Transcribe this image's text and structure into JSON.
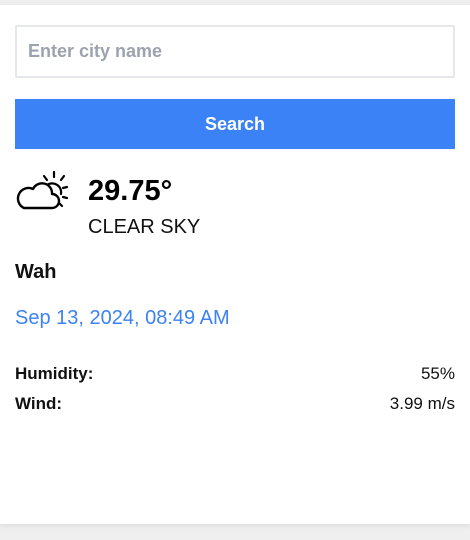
{
  "search": {
    "placeholder": "Enter city name",
    "value": "",
    "button_label": "Search"
  },
  "weather": {
    "icon": "partly-cloudy-day-icon",
    "temperature": "29.75°",
    "condition": "CLEAR SKY",
    "city": "Wah",
    "datetime": "Sep 13, 2024, 08:49 AM"
  },
  "details": {
    "humidity_label": "Humidity:",
    "humidity_value": "55%",
    "wind_label": "Wind:",
    "wind_value": "3.99 m/s"
  },
  "colors": {
    "accent": "#3b82f6",
    "background": "#ffffff"
  }
}
